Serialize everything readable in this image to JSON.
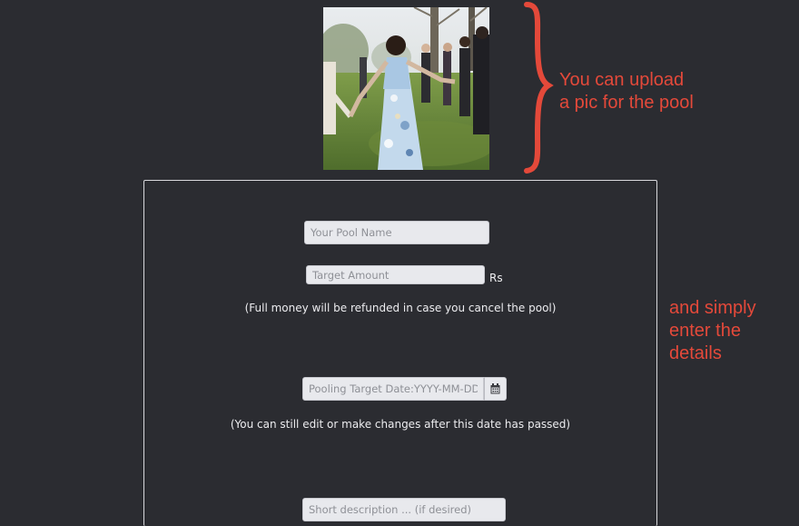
{
  "annotations": {
    "upload_line1": "You can upload",
    "upload_line2": "a pic for the pool",
    "details_line1": "and simply",
    "details_line2": "enter the",
    "details_line3": "details"
  },
  "form": {
    "pool_name_placeholder": "Your Pool Name",
    "target_amount_placeholder": "Target Amount",
    "currency_label": "Rs",
    "refund_note": "(Full money will be refunded in case you cancel the pool)",
    "date_placeholder": "Pooling Target Date:YYYY-MM-DD",
    "date_icon": "calendar-icon",
    "edit_note": "(You can still edit or make changes after this date has passed)",
    "description_placeholder": "Short description ... (if desired)"
  },
  "colors": {
    "background": "#2b2c31",
    "annotation": "#e4493a",
    "panel_border": "#d8d8dc",
    "field_background": "#e8e9ed"
  }
}
